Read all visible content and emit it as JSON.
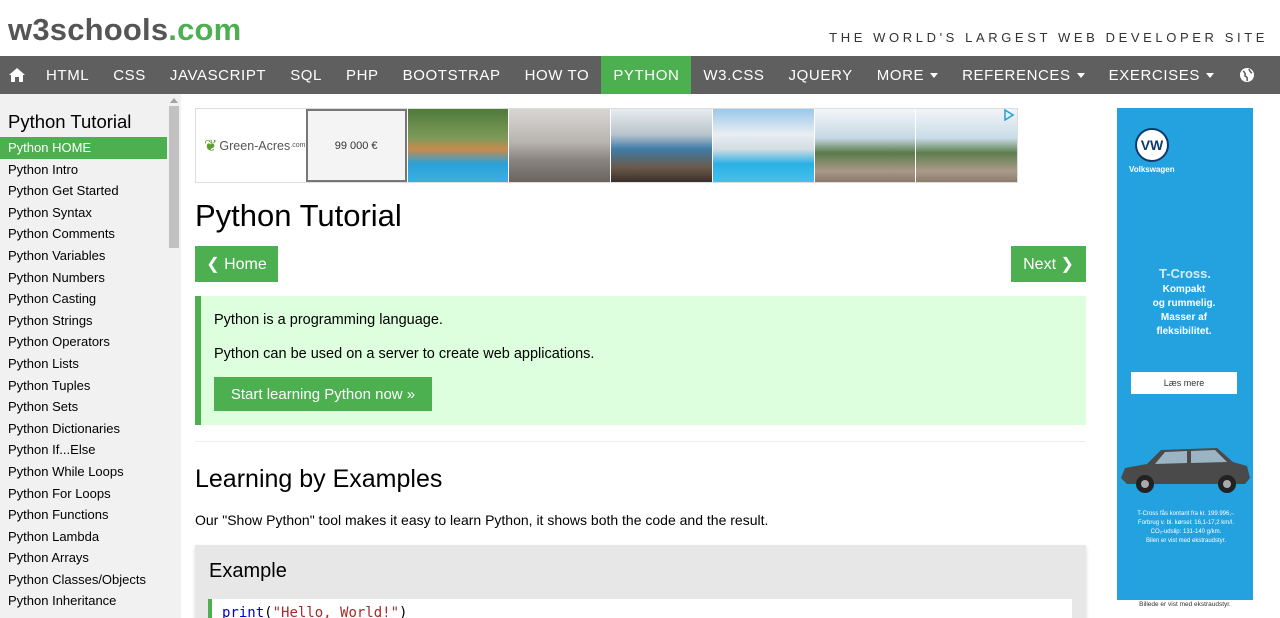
{
  "header": {
    "logo_main": "w3schools",
    "logo_dot": ".com",
    "tagline": "THE WORLD'S LARGEST WEB DEVELOPER SITE"
  },
  "nav": {
    "items": [
      {
        "label": "HTML"
      },
      {
        "label": "CSS"
      },
      {
        "label": "JAVASCRIPT"
      },
      {
        "label": "SQL"
      },
      {
        "label": "PHP"
      },
      {
        "label": "BOOTSTRAP"
      },
      {
        "label": "HOW TO"
      },
      {
        "label": "PYTHON",
        "active": true
      },
      {
        "label": "W3.CSS"
      },
      {
        "label": "JQUERY"
      },
      {
        "label": "MORE"
      }
    ],
    "right": [
      {
        "label": "REFERENCES"
      },
      {
        "label": "EXERCISES"
      }
    ],
    "active_color": "#4CAF50",
    "bar_color": "#5f5f5f"
  },
  "sidebar": {
    "title": "Python Tutorial",
    "items": [
      "Python HOME",
      "Python Intro",
      "Python Get Started",
      "Python Syntax",
      "Python Comments",
      "Python Variables",
      "Python Numbers",
      "Python Casting",
      "Python Strings",
      "Python Operators",
      "Python Lists",
      "Python Tuples",
      "Python Sets",
      "Python Dictionaries",
      "Python If...Else",
      "Python While Loops",
      "Python For Loops",
      "Python Functions",
      "Python Lambda",
      "Python Arrays",
      "Python Classes/Objects",
      "Python Inheritance"
    ],
    "active_index": 0
  },
  "ad_top": {
    "brand": "Green-Acres",
    "brand_suffix": ".com",
    "price": "99 000 €"
  },
  "main": {
    "title": "Python Tutorial",
    "home_btn": "❮ Home",
    "next_btn": "Next ❯",
    "note_p1": "Python is a programming language.",
    "note_p2": "Python can be used on a server to create web applications.",
    "start_btn": "Start learning Python now »",
    "h2": "Learning by Examples",
    "lead": "Our \"Show Python\" tool makes it easy to learn Python, it shows both the code and the result.",
    "example_title": "Example",
    "code_fn": "print",
    "code_open": "(",
    "code_str": "\"Hello, World!\"",
    "code_close": ")"
  },
  "ad_right": {
    "brand": "Volkswagen",
    "title": "T-Cross.",
    "line1": "Kompakt",
    "line2": "og rummelig.",
    "line3": "Masser af",
    "line4": "fleksibilitet.",
    "cta": "Læs mere",
    "fine1": "T-Cross fås kontant fra kr. 199.996,-.",
    "fine2": "Forbrug v. bl. kørsel: 16,1-17,2 km/l.",
    "fine3": "CO₂-udslip: 131-140 g/km.",
    "fine4": "Bilen er vist med ekstraudstyr.",
    "bottom": "Billede er vist med ekstraudstyr."
  }
}
